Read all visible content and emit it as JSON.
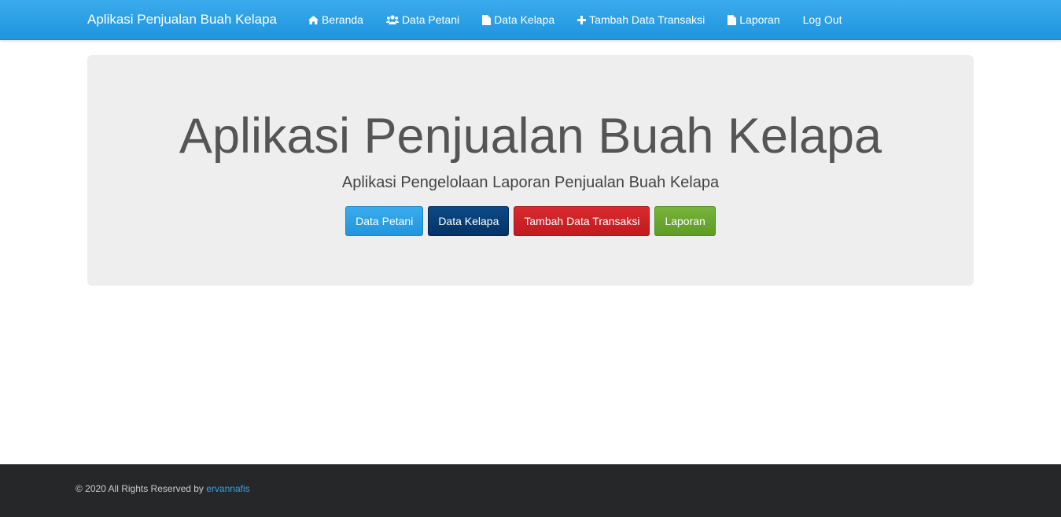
{
  "navbar": {
    "brand": "Aplikasi Penjualan Buah Kelapa",
    "items": [
      {
        "label": "Beranda",
        "icon": "home-icon"
      },
      {
        "label": "Data Petani",
        "icon": "users-icon"
      },
      {
        "label": "Data Kelapa",
        "icon": "file-icon"
      },
      {
        "label": "Tambah Data Transaksi",
        "icon": "plus-icon"
      },
      {
        "label": "Laporan",
        "icon": "file-icon"
      },
      {
        "label": "Log Out",
        "icon": ""
      }
    ]
  },
  "hero": {
    "title": "Aplikasi Penjualan Buah Kelapa",
    "subtitle": "Aplikasi Pengelolaan Laporan Penjualan Buah Kelapa",
    "buttons": [
      {
        "label": "Data Petani",
        "color": "#2a9ee4"
      },
      {
        "label": "Data Kelapa",
        "color": "#073f77"
      },
      {
        "label": "Tambah Data Transaksi",
        "color": "#cc2026"
      },
      {
        "label": "Laporan",
        "color": "#6aa82f"
      }
    ]
  },
  "footer": {
    "text": "© 2020 All Rights Reserved by ",
    "author": "ervannafis"
  },
  "colors": {
    "navbar": "#2a9fe6",
    "jumbotron": "#eeeeee",
    "footer": "#262729",
    "link": "#2fa4e7"
  }
}
